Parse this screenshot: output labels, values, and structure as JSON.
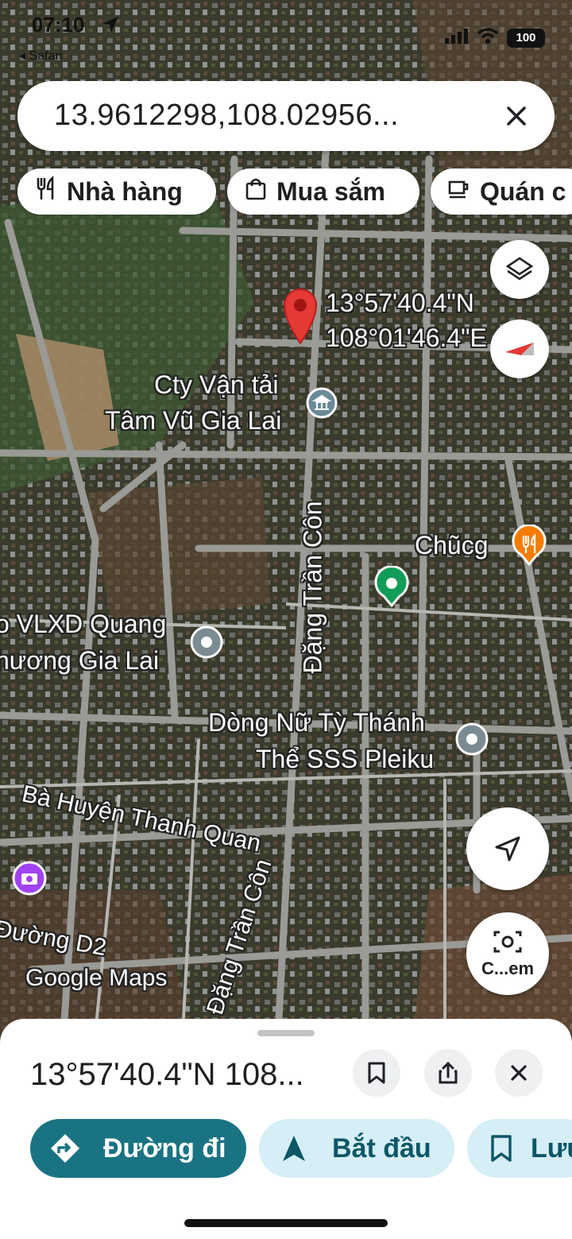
{
  "status_bar": {
    "time": "07:10",
    "back_label": "◂ Safari",
    "battery": "100"
  },
  "search": {
    "query": "13.9612298,108.02956..."
  },
  "chips": [
    {
      "label": "Nhà hàng",
      "icon": "fork-knife-icon"
    },
    {
      "label": "Mua sắm",
      "icon": "shopping-bag-icon"
    },
    {
      "label": "Quán c",
      "icon": "coffee-cup-icon"
    }
  ],
  "pin": {
    "lat": "13°57'40.4\"N",
    "lng": "108°01'46.4\"E"
  },
  "places": [
    {
      "line1": "Cty Vận tải",
      "line2": "Tâm Vũ Gia Lai",
      "icon": "bank-icon"
    },
    {
      "line1": "Chũcg",
      "icon": "restaurant-icon"
    },
    {
      "line1": "o VLXD Quang",
      "line2": "hương Gia Lai",
      "icon": "place-icon"
    },
    {
      "line1": "Dòng Nữ Tỳ Thánh",
      "line2": "Thể SSS Pleiku",
      "icon": "place-icon"
    },
    {
      "icon": "green-place-icon"
    },
    {
      "icon": "camera-icon"
    }
  ],
  "streets": [
    {
      "name": "Đặng Trần Côn"
    },
    {
      "name": "Bà Huyện Thanh Quan"
    },
    {
      "name": "Đặng Trần Côn"
    },
    {
      "name": "Đường D2"
    }
  ],
  "watermark": "Google Maps",
  "buttons": {
    "search_this_area": "C...em"
  },
  "sheet": {
    "title": "13°57'40.4\"N 108...",
    "actions": [
      {
        "label": "Đường đi",
        "icon": "directions-icon"
      },
      {
        "label": "Bắt đầu",
        "icon": "navigation-arrow-icon"
      },
      {
        "label": "Lưu",
        "icon": "bookmark-icon"
      }
    ]
  },
  "colors": {
    "primary": "#1a7383",
    "chip_light": "#d6eef5",
    "pin": "#e53935",
    "accent_text": "#0b5767"
  }
}
